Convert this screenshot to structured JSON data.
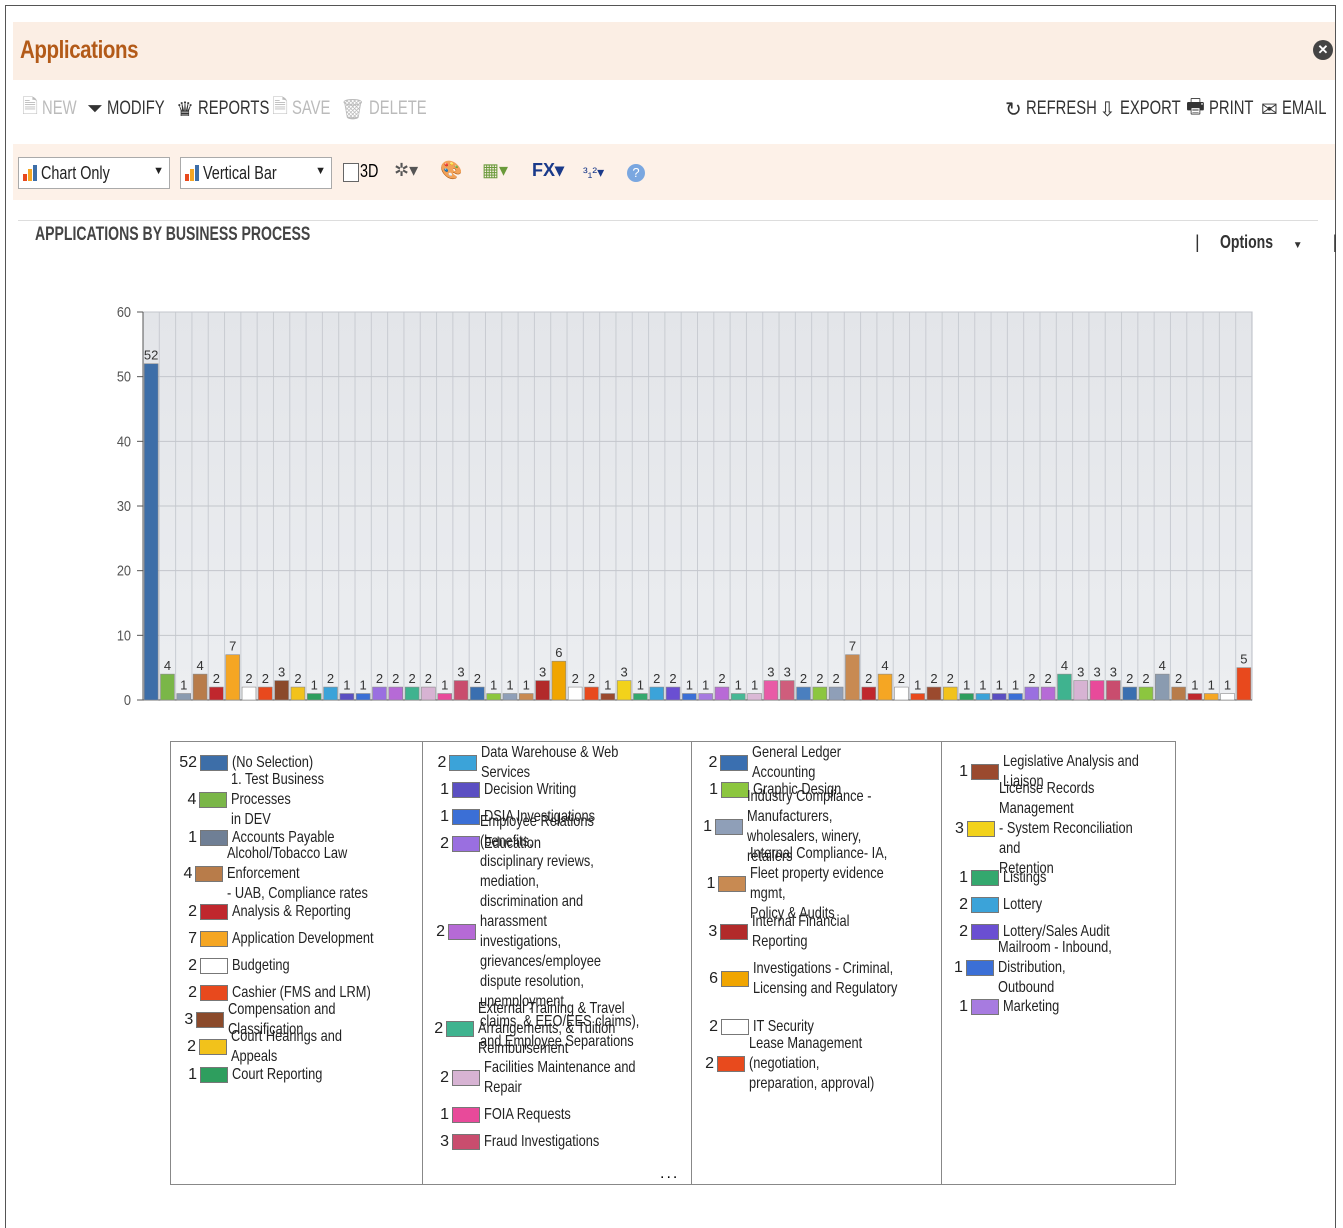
{
  "window": {
    "title": "Applications",
    "close_icon": "close-icon"
  },
  "toolbar": {
    "left": [
      {
        "label": "NEW",
        "icon": "new-icon",
        "enabled": false
      },
      {
        "label": "MODIFY",
        "icon": "filter-icon",
        "enabled": true
      },
      {
        "label": "REPORTS",
        "icon": "reports-icon",
        "enabled": true
      },
      {
        "label": "SAVE",
        "icon": "save-icon",
        "enabled": false
      },
      {
        "label": "DELETE",
        "icon": "trash-icon",
        "enabled": false
      }
    ],
    "right": [
      {
        "label": "REFRESH",
        "icon": "refresh-icon"
      },
      {
        "label": "EXPORT",
        "icon": "export-icon"
      },
      {
        "label": "PRINT",
        "icon": "print-icon"
      },
      {
        "label": "EMAIL",
        "icon": "email-icon"
      }
    ]
  },
  "chart_options": {
    "view_select": "Chart Only",
    "type_select": "Vertical Bar",
    "three_d_label": "3D",
    "three_d_checked": false,
    "fx_label": "FX",
    "sort_label": "³₁²"
  },
  "chart_panel": {
    "title": "APPLICATIONS BY BUSINESS PROCESS",
    "options_label": "Options"
  },
  "chart_data": {
    "type": "bar",
    "ylim": [
      0,
      60
    ],
    "yticks": [
      0,
      10,
      20,
      30,
      40,
      50,
      60
    ],
    "grid": true,
    "values": [
      52,
      4,
      1,
      4,
      2,
      7,
      2,
      2,
      3,
      2,
      1,
      2,
      1,
      1,
      2,
      2,
      2,
      2,
      1,
      3,
      2,
      1,
      1,
      1,
      3,
      6,
      2,
      2,
      1,
      3,
      1,
      2,
      2,
      1,
      1,
      2,
      1,
      1,
      3,
      3,
      2,
      2,
      2,
      7,
      2,
      4,
      2,
      1,
      2,
      2,
      1,
      1,
      1,
      1,
      2,
      2,
      4,
      3,
      3,
      3,
      2,
      2,
      4,
      2,
      1,
      1,
      1,
      5
    ],
    "colors": [
      "#3d6ea8",
      "#7ab648",
      "#8a9bb0",
      "#b87c4a",
      "#c0272d",
      "#f5a623",
      "#ffffff",
      "#e8491d",
      "#8b4a2b",
      "#f2c21b",
      "#2e9e5e",
      "#3ba3d9",
      "#5b4fc2",
      "#3b6fd6",
      "#9a6fe0",
      "#b66ad6",
      "#3fb38f",
      "#d7b3d3",
      "#e84a9a",
      "#c94d6e",
      "#3a6fb0",
      "#8cc63f",
      "#8f9fb8",
      "#c88a52",
      "#b22a2a",
      "#f0a500",
      "#ffffff",
      "#e84a1d",
      "#9b4a2e",
      "#f2d21b",
      "#34a86e",
      "#3ba3d9",
      "#6a4fd2",
      "#3b6fd6",
      "#a77be0",
      "#b86ad6",
      "#46b895",
      "#dbb9d6",
      "#e85aa6",
      "#cf5d7c",
      "#4a7fbf",
      "#8cc63f",
      "#8f9fb8",
      "#c88a52",
      "#c0272d",
      "#f5a623",
      "#ffffff",
      "#e8491d",
      "#9b4a2e",
      "#f2c21b",
      "#2e9e5e",
      "#3ba3d9",
      "#5b4fc2",
      "#3b6fd6",
      "#9a6fe0",
      "#b66ad6",
      "#3fb38f",
      "#d7b3d3",
      "#e84a9a",
      "#c94d6e",
      "#3a6fb0",
      "#8cc63f",
      "#8a9bb0",
      "#b87c4a",
      "#c0272d",
      "#f5a623",
      "#ffffff",
      "#e8491d"
    ],
    "legend": [
      {
        "count": "52",
        "label": "(No Selection)",
        "color": "#3d6ea8"
      },
      {
        "count": "4",
        "label": "1. Test Business Processes\nin DEV",
        "color": "#7ab648"
      },
      {
        "count": "1",
        "label": "Accounts Payable",
        "color": "#6f7f95"
      },
      {
        "count": "4",
        "label": "Alcohol/Tobacco Law Enforcement\n- UAB, Compliance rates",
        "color": "#b87c4a"
      },
      {
        "count": "2",
        "label": "Analysis & Reporting",
        "color": "#c0272d"
      },
      {
        "count": "7",
        "label": "Application Development",
        "color": "#f5a623"
      },
      {
        "count": "2",
        "label": "Budgeting",
        "color": "#ffffff"
      },
      {
        "count": "2",
        "label": "Cashier (FMS and LRM)",
        "color": "#e8491d"
      },
      {
        "count": "3",
        "label": "Compensation and Classification",
        "color": "#8b4a2b"
      },
      {
        "count": "2",
        "label": "Court Hearings and Appeals",
        "color": "#f2c21b"
      },
      {
        "count": "1",
        "label": "Court Reporting",
        "color": "#2e9e5e"
      },
      {
        "count": "2",
        "label": "Data Warehouse & Web Services",
        "color": "#3ba3d9"
      },
      {
        "count": "1",
        "label": "Decision Writing",
        "color": "#5b4fc2"
      },
      {
        "count": "1",
        "label": "DSIA Investigations",
        "color": "#3b6fd6"
      },
      {
        "count": "2",
        "label": "Education",
        "color": "#9a6fe0"
      },
      {
        "count": "2",
        "label": "Employee Relations (benefits,\ndisciplinary reviews, mediation,\ndiscrimination and harassment\ninvestigations, grievances/employee\ndispute resolution, unemployment\nclaims, & EEO/EES claims),\nand Employee Separations",
        "color": "#b66ad6"
      },
      {
        "count": "2",
        "label": "External Training & Travel\nArrangements, & Tuition Reimbursement",
        "color": "#3fb38f"
      },
      {
        "count": "2",
        "label": "Facilities Maintenance and\nRepair",
        "color": "#d7b3d3"
      },
      {
        "count": "1",
        "label": "FOIA Requests",
        "color": "#e84a9a"
      },
      {
        "count": "3",
        "label": "Fraud Investigations",
        "color": "#c94d6e"
      },
      {
        "count": "2",
        "label": "General Ledger Accounting",
        "color": "#3a6fb0"
      },
      {
        "count": "1",
        "label": "Graphic Design",
        "color": "#8cc63f"
      },
      {
        "count": "1",
        "label": "Industry Compliance - Manufacturers,\nwholesalers, winery, retailers",
        "color": "#8f9fb8"
      },
      {
        "count": "1",
        "label": "Internal Compliance- IA,\nFleet property evidence mgmt,\nPolicy & Audits",
        "color": "#c88a52"
      },
      {
        "count": "3",
        "label": "Internal Financial Reporting",
        "color": "#b22a2a"
      },
      {
        "count": "6",
        "label": "Investigations - Criminal,\nLicensing and Regulatory",
        "color": "#f0a500"
      },
      {
        "count": "2",
        "label": "IT Security",
        "color": "#ffffff"
      },
      {
        "count": "2",
        "label": "Lease Management (negotiation,\npreparation, approval)",
        "color": "#e84a1d"
      },
      {
        "count": "1",
        "label": "Legislative Analysis and\nLiaison",
        "color": "#9b4a2e"
      },
      {
        "count": "3",
        "label": "License Records Management\n- System Reconciliation and\nRetention",
        "color": "#f2d21b"
      },
      {
        "count": "1",
        "label": "Listings",
        "color": "#34a86e"
      },
      {
        "count": "2",
        "label": "Lottery",
        "color": "#3ba3d9"
      },
      {
        "count": "2",
        "label": "Lottery/Sales Audit",
        "color": "#6a4fd2"
      },
      {
        "count": "1",
        "label": "Mailroom - Inbound, Distribution,\nOutbound",
        "color": "#3b6fd6"
      },
      {
        "count": "1",
        "label": "Marketing",
        "color": "#a77be0"
      }
    ],
    "more_indicator": "..."
  }
}
